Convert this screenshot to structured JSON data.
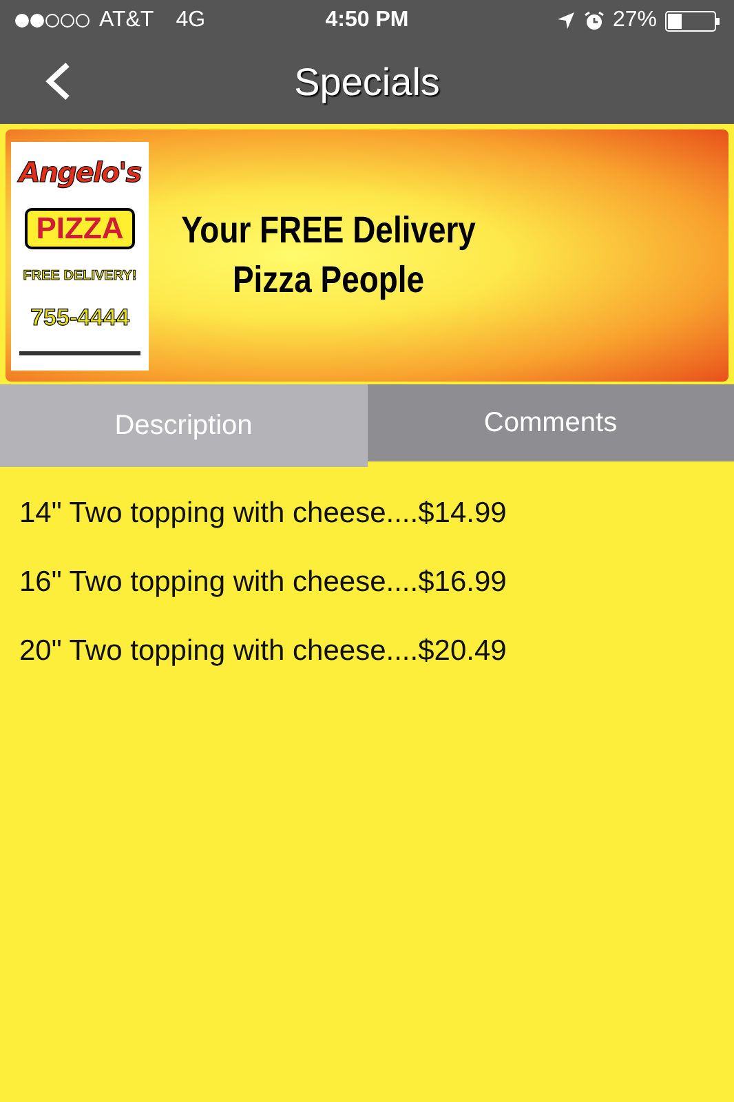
{
  "status_bar": {
    "carrier": "AT&T",
    "network": "4G",
    "time": "4:50 PM",
    "battery": "27%"
  },
  "nav": {
    "title": "Specials"
  },
  "banner": {
    "logo": {
      "name": "Angelo's",
      "product": "PIZZA",
      "tagline": "FREE DELIVERY!",
      "phone": "755-4444"
    },
    "headline": [
      "Your FREE Delivery",
      "Pizza People"
    ]
  },
  "tabs": [
    {
      "label": "Description",
      "selected": true
    },
    {
      "label": "Comments",
      "selected": false
    }
  ],
  "items": [
    "14\" Two topping with cheese....$14.99",
    "16\" Two topping with cheese....$16.99",
    "20\" Two topping with cheese....$20.49"
  ]
}
